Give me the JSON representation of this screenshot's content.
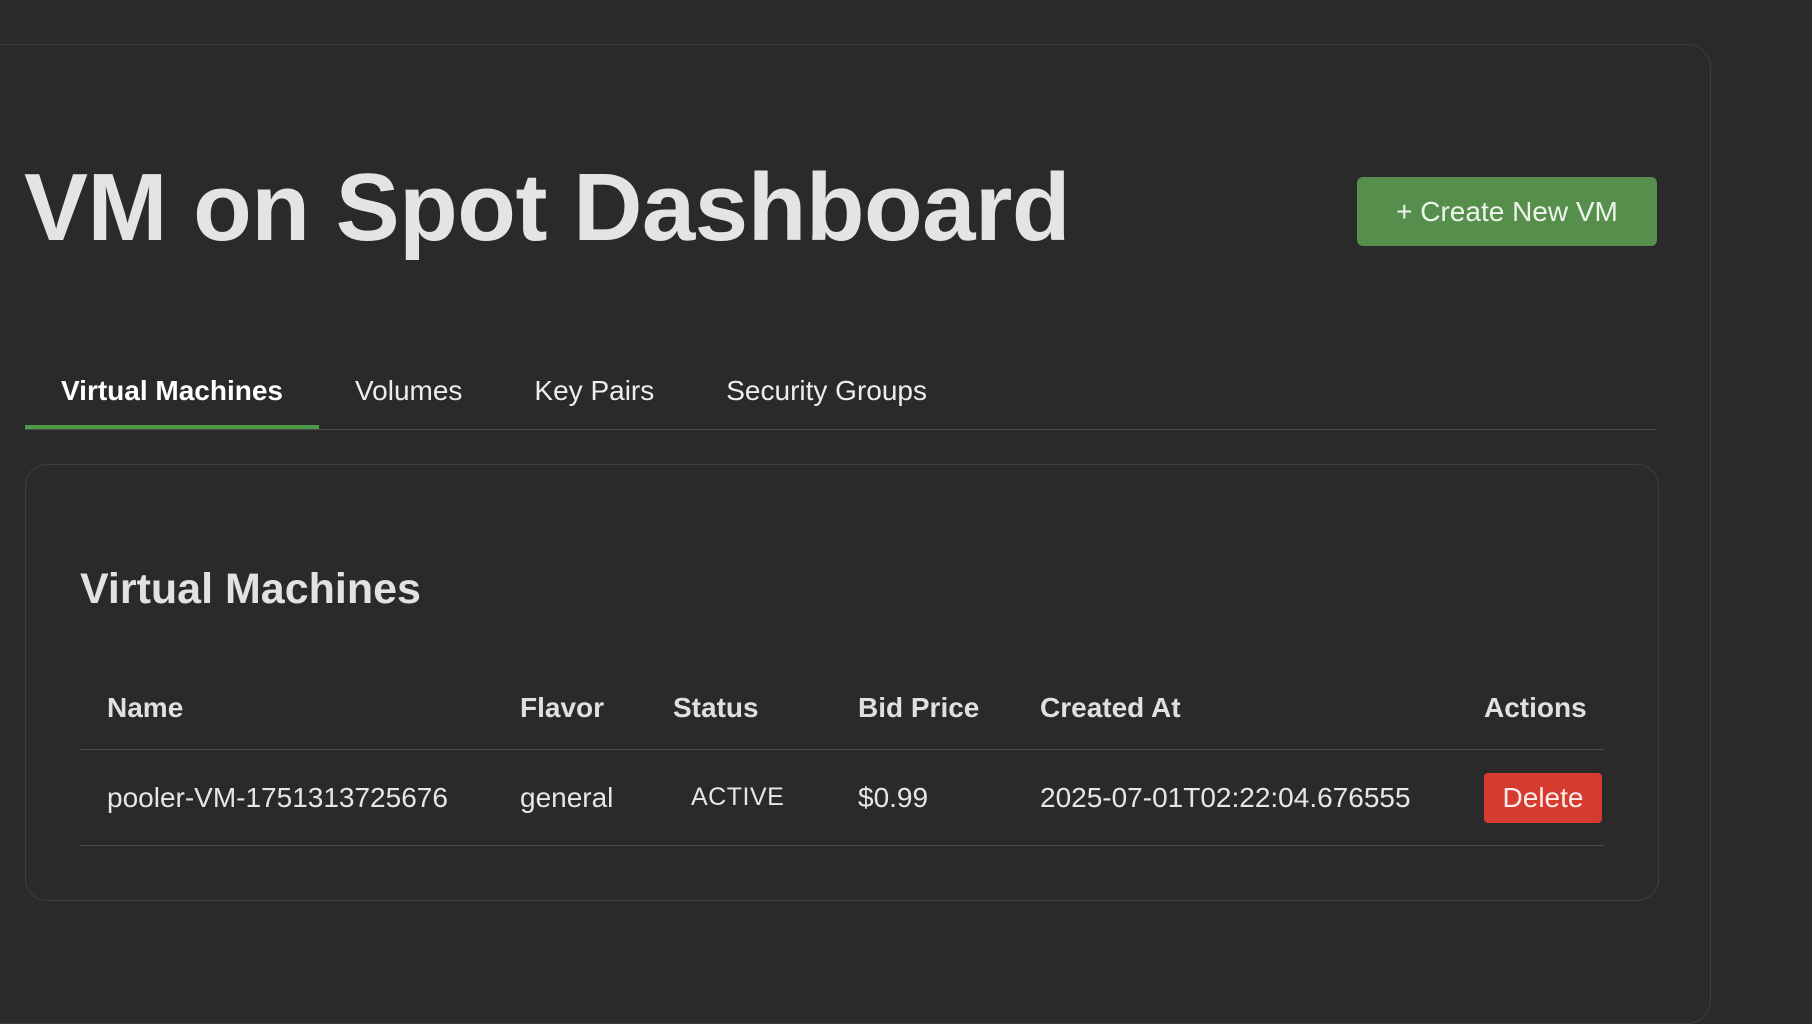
{
  "header": {
    "title": "VM on Spot Dashboard",
    "create_button_label": "+ Create New VM"
  },
  "tabs": [
    {
      "label": "Virtual Machines",
      "active": true
    },
    {
      "label": "Volumes",
      "active": false
    },
    {
      "label": "Key Pairs",
      "active": false
    },
    {
      "label": "Security Groups",
      "active": false
    }
  ],
  "vm_section": {
    "title": "Virtual Machines",
    "columns": [
      "Name",
      "Flavor",
      "Status",
      "Bid Price",
      "Created At",
      "Actions"
    ],
    "rows": [
      {
        "name": "pooler-VM-1751313725676",
        "flavor": "general",
        "status": "ACTIVE",
        "bid_price": "$0.99",
        "created_at": "2025-07-01T02:22:04.676555",
        "action_label": "Delete"
      }
    ]
  },
  "colors": {
    "background": "#2a2a2a",
    "primary_button": "#568f4b",
    "active_tab_underline": "#4c9a47",
    "danger_button": "#d63b2f"
  }
}
